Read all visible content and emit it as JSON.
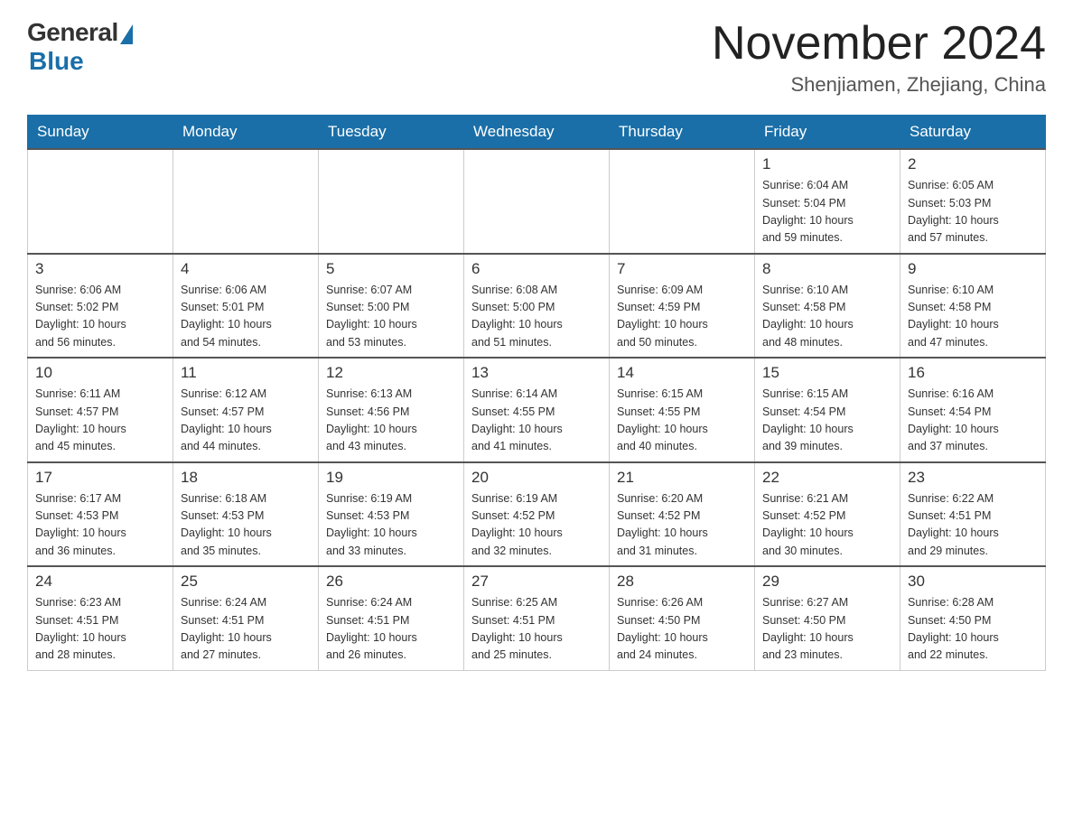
{
  "logo": {
    "general": "General",
    "blue": "Blue"
  },
  "title": "November 2024",
  "location": "Shenjiamen, Zhejiang, China",
  "weekdays": [
    "Sunday",
    "Monday",
    "Tuesday",
    "Wednesday",
    "Thursday",
    "Friday",
    "Saturday"
  ],
  "weeks": [
    [
      {
        "day": "",
        "info": ""
      },
      {
        "day": "",
        "info": ""
      },
      {
        "day": "",
        "info": ""
      },
      {
        "day": "",
        "info": ""
      },
      {
        "day": "",
        "info": ""
      },
      {
        "day": "1",
        "info": "Sunrise: 6:04 AM\nSunset: 5:04 PM\nDaylight: 10 hours\nand 59 minutes."
      },
      {
        "day": "2",
        "info": "Sunrise: 6:05 AM\nSunset: 5:03 PM\nDaylight: 10 hours\nand 57 minutes."
      }
    ],
    [
      {
        "day": "3",
        "info": "Sunrise: 6:06 AM\nSunset: 5:02 PM\nDaylight: 10 hours\nand 56 minutes."
      },
      {
        "day": "4",
        "info": "Sunrise: 6:06 AM\nSunset: 5:01 PM\nDaylight: 10 hours\nand 54 minutes."
      },
      {
        "day": "5",
        "info": "Sunrise: 6:07 AM\nSunset: 5:00 PM\nDaylight: 10 hours\nand 53 minutes."
      },
      {
        "day": "6",
        "info": "Sunrise: 6:08 AM\nSunset: 5:00 PM\nDaylight: 10 hours\nand 51 minutes."
      },
      {
        "day": "7",
        "info": "Sunrise: 6:09 AM\nSunset: 4:59 PM\nDaylight: 10 hours\nand 50 minutes."
      },
      {
        "day": "8",
        "info": "Sunrise: 6:10 AM\nSunset: 4:58 PM\nDaylight: 10 hours\nand 48 minutes."
      },
      {
        "day": "9",
        "info": "Sunrise: 6:10 AM\nSunset: 4:58 PM\nDaylight: 10 hours\nand 47 minutes."
      }
    ],
    [
      {
        "day": "10",
        "info": "Sunrise: 6:11 AM\nSunset: 4:57 PM\nDaylight: 10 hours\nand 45 minutes."
      },
      {
        "day": "11",
        "info": "Sunrise: 6:12 AM\nSunset: 4:57 PM\nDaylight: 10 hours\nand 44 minutes."
      },
      {
        "day": "12",
        "info": "Sunrise: 6:13 AM\nSunset: 4:56 PM\nDaylight: 10 hours\nand 43 minutes."
      },
      {
        "day": "13",
        "info": "Sunrise: 6:14 AM\nSunset: 4:55 PM\nDaylight: 10 hours\nand 41 minutes."
      },
      {
        "day": "14",
        "info": "Sunrise: 6:15 AM\nSunset: 4:55 PM\nDaylight: 10 hours\nand 40 minutes."
      },
      {
        "day": "15",
        "info": "Sunrise: 6:15 AM\nSunset: 4:54 PM\nDaylight: 10 hours\nand 39 minutes."
      },
      {
        "day": "16",
        "info": "Sunrise: 6:16 AM\nSunset: 4:54 PM\nDaylight: 10 hours\nand 37 minutes."
      }
    ],
    [
      {
        "day": "17",
        "info": "Sunrise: 6:17 AM\nSunset: 4:53 PM\nDaylight: 10 hours\nand 36 minutes."
      },
      {
        "day": "18",
        "info": "Sunrise: 6:18 AM\nSunset: 4:53 PM\nDaylight: 10 hours\nand 35 minutes."
      },
      {
        "day": "19",
        "info": "Sunrise: 6:19 AM\nSunset: 4:53 PM\nDaylight: 10 hours\nand 33 minutes."
      },
      {
        "day": "20",
        "info": "Sunrise: 6:19 AM\nSunset: 4:52 PM\nDaylight: 10 hours\nand 32 minutes."
      },
      {
        "day": "21",
        "info": "Sunrise: 6:20 AM\nSunset: 4:52 PM\nDaylight: 10 hours\nand 31 minutes."
      },
      {
        "day": "22",
        "info": "Sunrise: 6:21 AM\nSunset: 4:52 PM\nDaylight: 10 hours\nand 30 minutes."
      },
      {
        "day": "23",
        "info": "Sunrise: 6:22 AM\nSunset: 4:51 PM\nDaylight: 10 hours\nand 29 minutes."
      }
    ],
    [
      {
        "day": "24",
        "info": "Sunrise: 6:23 AM\nSunset: 4:51 PM\nDaylight: 10 hours\nand 28 minutes."
      },
      {
        "day": "25",
        "info": "Sunrise: 6:24 AM\nSunset: 4:51 PM\nDaylight: 10 hours\nand 27 minutes."
      },
      {
        "day": "26",
        "info": "Sunrise: 6:24 AM\nSunset: 4:51 PM\nDaylight: 10 hours\nand 26 minutes."
      },
      {
        "day": "27",
        "info": "Sunrise: 6:25 AM\nSunset: 4:51 PM\nDaylight: 10 hours\nand 25 minutes."
      },
      {
        "day": "28",
        "info": "Sunrise: 6:26 AM\nSunset: 4:50 PM\nDaylight: 10 hours\nand 24 minutes."
      },
      {
        "day": "29",
        "info": "Sunrise: 6:27 AM\nSunset: 4:50 PM\nDaylight: 10 hours\nand 23 minutes."
      },
      {
        "day": "30",
        "info": "Sunrise: 6:28 AM\nSunset: 4:50 PM\nDaylight: 10 hours\nand 22 minutes."
      }
    ]
  ]
}
